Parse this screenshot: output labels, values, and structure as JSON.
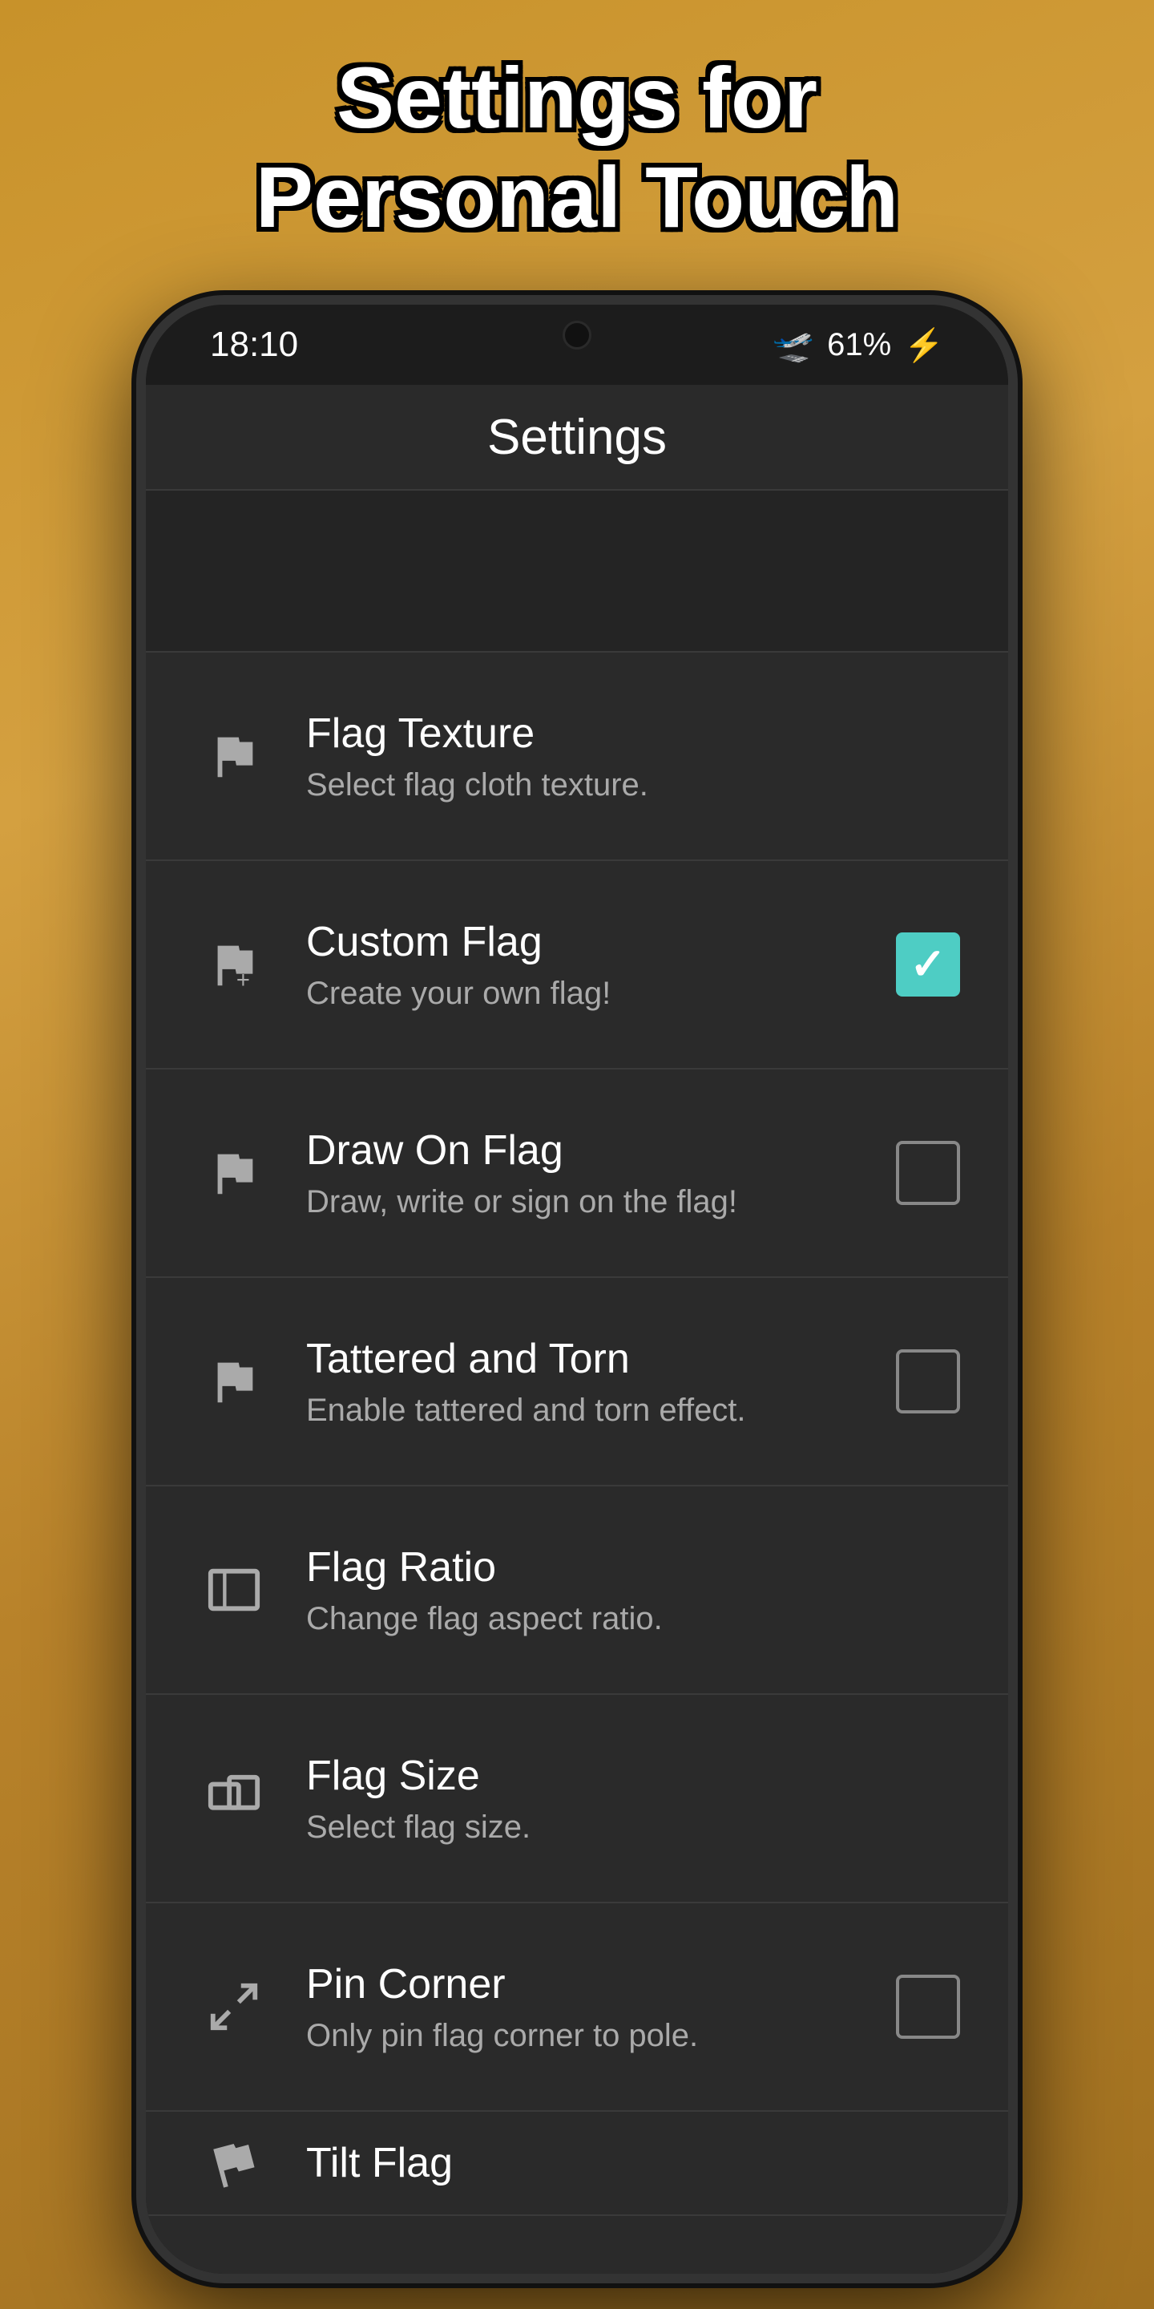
{
  "header": {
    "line1": "Settings for",
    "line2": "Personal Touch"
  },
  "statusBar": {
    "time": "18:10",
    "battery": "61%",
    "batteryIcon": "⚡",
    "airplaneIcon": "✈"
  },
  "appBar": {
    "title": "Settings"
  },
  "settingsItems": [
    {
      "id": "flag-texture",
      "title": "Flag Texture",
      "subtitle": "Select flag cloth texture.",
      "iconType": "flag-texture",
      "actionType": "none"
    },
    {
      "id": "custom-flag",
      "title": "Custom Flag",
      "subtitle": "Create your own flag!",
      "iconType": "flag-plus",
      "actionType": "checkbox",
      "checked": true
    },
    {
      "id": "draw-on-flag",
      "title": "Draw On Flag",
      "subtitle": "Draw, write or sign on the flag!",
      "iconType": "flag-draw",
      "actionType": "checkbox",
      "checked": false
    },
    {
      "id": "tattered-torn",
      "title": "Tattered and Torn",
      "subtitle": "Enable tattered and torn effect.",
      "iconType": "flag-torn",
      "actionType": "checkbox",
      "checked": false
    },
    {
      "id": "flag-ratio",
      "title": "Flag Ratio",
      "subtitle": "Change flag aspect ratio.",
      "iconType": "ratio",
      "actionType": "none"
    },
    {
      "id": "flag-size",
      "title": "Flag Size",
      "subtitle": "Select flag size.",
      "iconType": "resize",
      "actionType": "none"
    },
    {
      "id": "pin-corner",
      "title": "Pin Corner",
      "subtitle": "Only pin flag corner to pole.",
      "iconType": "expand",
      "actionType": "checkbox",
      "checked": false
    },
    {
      "id": "tilt-flag",
      "title": "Tilt Flag",
      "subtitle": "",
      "iconType": "tilt",
      "actionType": "none"
    }
  ]
}
